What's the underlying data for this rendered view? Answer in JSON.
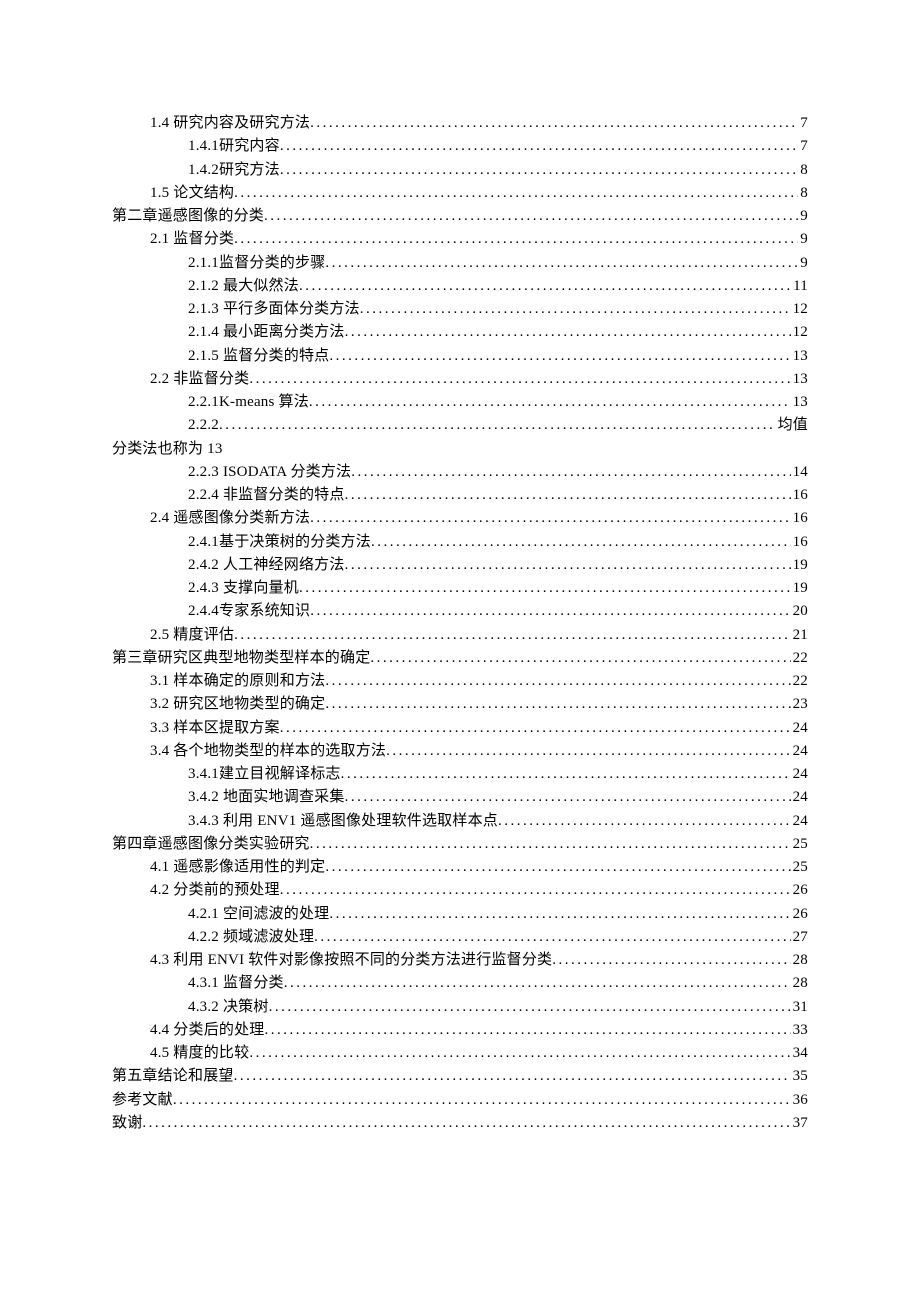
{
  "toc": [
    {
      "level": 1,
      "label": "1.4 研究内容及研究方法",
      "page": "7"
    },
    {
      "level": 2,
      "label": "1.4.1研究内容",
      "page": "7"
    },
    {
      "level": 2,
      "label": "1.4.2研究方法",
      "page": "8"
    },
    {
      "level": 1,
      "label": "1.5 论文结构",
      "page": "8"
    },
    {
      "level": 0,
      "label": "第二章遥感图像的分类",
      "page": "9"
    },
    {
      "level": 1,
      "label": "2.1 监督分类",
      "page": "9"
    },
    {
      "level": 2,
      "label": "2.1.1监督分类的步骤",
      "page": "9"
    },
    {
      "level": 2,
      "label": "2.1.2 最大似然法",
      "page": "11"
    },
    {
      "level": 2,
      "label": "2.1.3 平行多面体分类方法",
      "page": "12"
    },
    {
      "level": 2,
      "label": "2.1.4 最小距离分类方法",
      "page": "12"
    },
    {
      "level": 2,
      "label": "2.1.5 监督分类的特点",
      "page": "13"
    },
    {
      "level": 1,
      "label": "2.2 非监督分类",
      "page": "13"
    },
    {
      "level": 2,
      "label": "2.2.1K-means 算法",
      "page": "13"
    },
    {
      "level": 2,
      "label": "2.2.2",
      "page": "",
      "tail": "均值",
      "continued": true
    },
    {
      "level": 0,
      "label": "分类法也称为 13",
      "page": "",
      "noleader": true
    },
    {
      "level": 2,
      "label": "2.2.3 ISODATA 分类方法",
      "page": "14"
    },
    {
      "level": 2,
      "label": "2.2.4 非监督分类的特点",
      "page": "16"
    },
    {
      "level": 1,
      "label": "2.4 遥感图像分类新方法",
      "page": "16"
    },
    {
      "level": 2,
      "label": "2.4.1基于决策树的分类方法",
      "page": "16"
    },
    {
      "level": 2,
      "label": "2.4.2 人工神经网络方法",
      "page": "19"
    },
    {
      "level": 2,
      "label": "2.4.3 支撑向量机",
      "page": "19"
    },
    {
      "level": 2,
      "label": "2.4.4专家系统知识",
      "page": "20"
    },
    {
      "level": 1,
      "label": "2.5 精度评估",
      "page": "21"
    },
    {
      "level": 0,
      "label": "第三章研究区典型地物类型样本的确定",
      "page": "22"
    },
    {
      "level": 1,
      "label": "3.1 样本确定的原则和方法",
      "page": "22"
    },
    {
      "level": 1,
      "label": "3.2 研究区地物类型的确定",
      "page": "23"
    },
    {
      "level": 1,
      "label": "3.3 样本区提取方案",
      "page": "24"
    },
    {
      "level": 1,
      "label": "3.4 各个地物类型的样本的选取方法",
      "page": "24"
    },
    {
      "level": 2,
      "label": "3.4.1建立目视解译标志",
      "page": "24"
    },
    {
      "level": 2,
      "label": "3.4.2 地面实地调查采集",
      "page": "24"
    },
    {
      "level": 2,
      "label": "3.4.3 利用 ENV1 遥感图像处理软件选取样本点",
      "page": "24"
    },
    {
      "level": 0,
      "label": "第四章遥感图像分类实验研究",
      "page": "25"
    },
    {
      "level": 1,
      "label": "4.1 遥感影像适用性的判定",
      "page": "25"
    },
    {
      "level": 1,
      "label": "4.2 分类前的预处理",
      "page": "26"
    },
    {
      "level": 2,
      "label": "4.2.1 空间滤波的处理",
      "page": "26"
    },
    {
      "level": 2,
      "label": "4.2.2 频域滤波处理",
      "page": "27"
    },
    {
      "level": 1,
      "label": "4.3 利用 ENVI 软件对影像按照不同的分类方法进行监督分类",
      "page": "28"
    },
    {
      "level": 2,
      "label": "4.3.1 监督分类",
      "page": "28"
    },
    {
      "level": 2,
      "label": "4.3.2 决策树",
      "page": "31"
    },
    {
      "level": 1,
      "label": "4.4 分类后的处理",
      "page": "33"
    },
    {
      "level": 1,
      "label": "4.5 精度的比较",
      "page": "34"
    },
    {
      "level": 0,
      "label": "第五章结论和展望",
      "page": "35"
    },
    {
      "level": 0,
      "label": "参考文献",
      "page": "36"
    },
    {
      "level": 0,
      "label": "致谢",
      "page": "37"
    }
  ]
}
